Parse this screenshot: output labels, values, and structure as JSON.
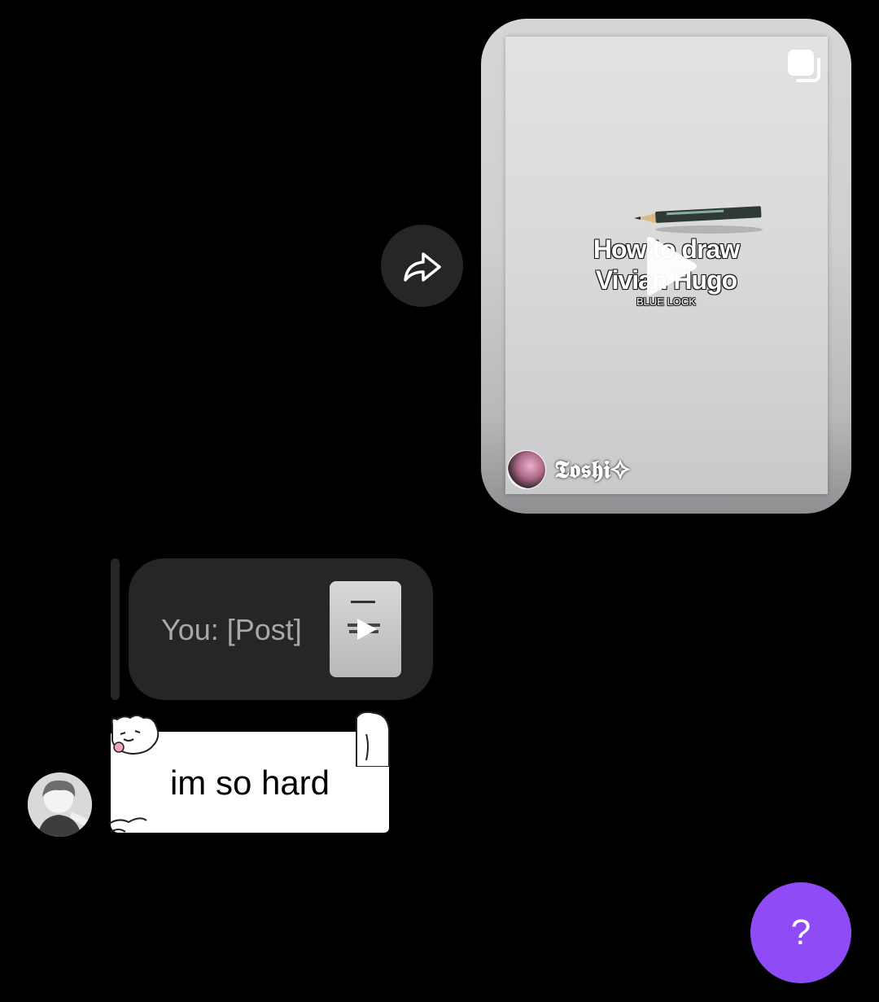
{
  "shared_post": {
    "title_line1": "How to draw",
    "title_line2": "Vivian Hugo",
    "subtitle": "BLUE LOCK",
    "author": "𝕿𝖔𝖘𝖍𝖎✧",
    "media_type": "reel",
    "multi_icon": "carousel-icon",
    "play_icon": "play-icon"
  },
  "share_button": {
    "icon": "share-arrow-icon"
  },
  "reply_preview": {
    "text": "You: [Post]",
    "thumb_icon": "play-icon"
  },
  "message": {
    "text": "im so hard",
    "bubble_style": "cat-sticker-frame"
  },
  "help_button": {
    "label": "?",
    "color": "#8f4cf6"
  },
  "colors": {
    "background": "#000000",
    "bubble_dark": "#262626",
    "reply_text": "#a8a8a8"
  }
}
